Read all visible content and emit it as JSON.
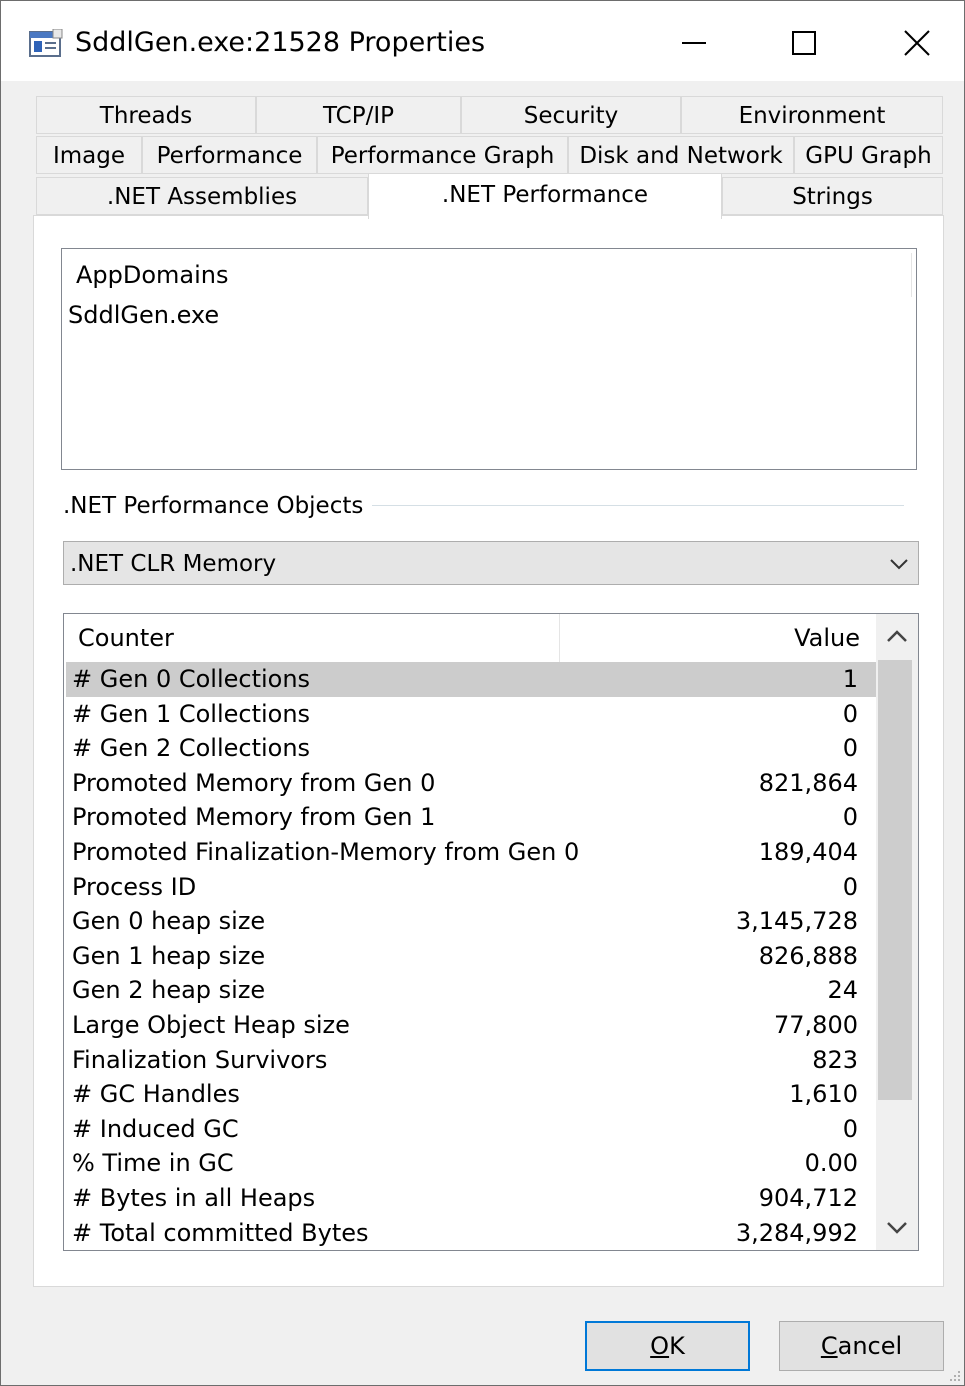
{
  "window": {
    "title": "SddlGen.exe:21528 Properties"
  },
  "tabs": {
    "row1": [
      "Threads",
      "TCP/IP",
      "Security",
      "Environment"
    ],
    "row2": [
      "Image",
      "Performance",
      "Performance Graph",
      "Disk and Network",
      "GPU Graph"
    ],
    "row3": [
      ".NET Assemblies",
      ".NET Performance",
      "Strings"
    ],
    "active": ".NET Performance"
  },
  "appdomains": {
    "header": "AppDomains",
    "items": [
      "SddlGen.exe"
    ]
  },
  "objects": {
    "label": ".NET Performance Objects",
    "selected": ".NET CLR Memory"
  },
  "counters": {
    "col_counter": "Counter",
    "col_value": "Value",
    "rows": [
      {
        "name": "# Gen 0 Collections",
        "value": "1"
      },
      {
        "name": "# Gen 1 Collections",
        "value": "0"
      },
      {
        "name": "# Gen 2 Collections",
        "value": "0"
      },
      {
        "name": "Promoted Memory from Gen 0",
        "value": "821,864"
      },
      {
        "name": "Promoted Memory from Gen 1",
        "value": "0"
      },
      {
        "name": "Promoted Finalization-Memory from Gen 0",
        "value": "189,404"
      },
      {
        "name": "Process ID",
        "value": "0"
      },
      {
        "name": "Gen 0 heap size",
        "value": "3,145,728"
      },
      {
        "name": "Gen 1 heap size",
        "value": "826,888"
      },
      {
        "name": "Gen 2 heap size",
        "value": "24"
      },
      {
        "name": "Large Object Heap size",
        "value": "77,800"
      },
      {
        "name": "Finalization Survivors",
        "value": "823"
      },
      {
        "name": "# GC Handles",
        "value": "1,610"
      },
      {
        "name": "# Induced GC",
        "value": "0"
      },
      {
        "name": "% Time in GC",
        "value": "0.00"
      },
      {
        "name": "# Bytes in all Heaps",
        "value": "904,712"
      },
      {
        "name": "# Total committed Bytes",
        "value": "3,284,992"
      }
    ]
  },
  "buttons": {
    "ok_accel": "O",
    "ok_rest": "K",
    "cancel_accel": "C",
    "cancel_rest": "ancel"
  }
}
